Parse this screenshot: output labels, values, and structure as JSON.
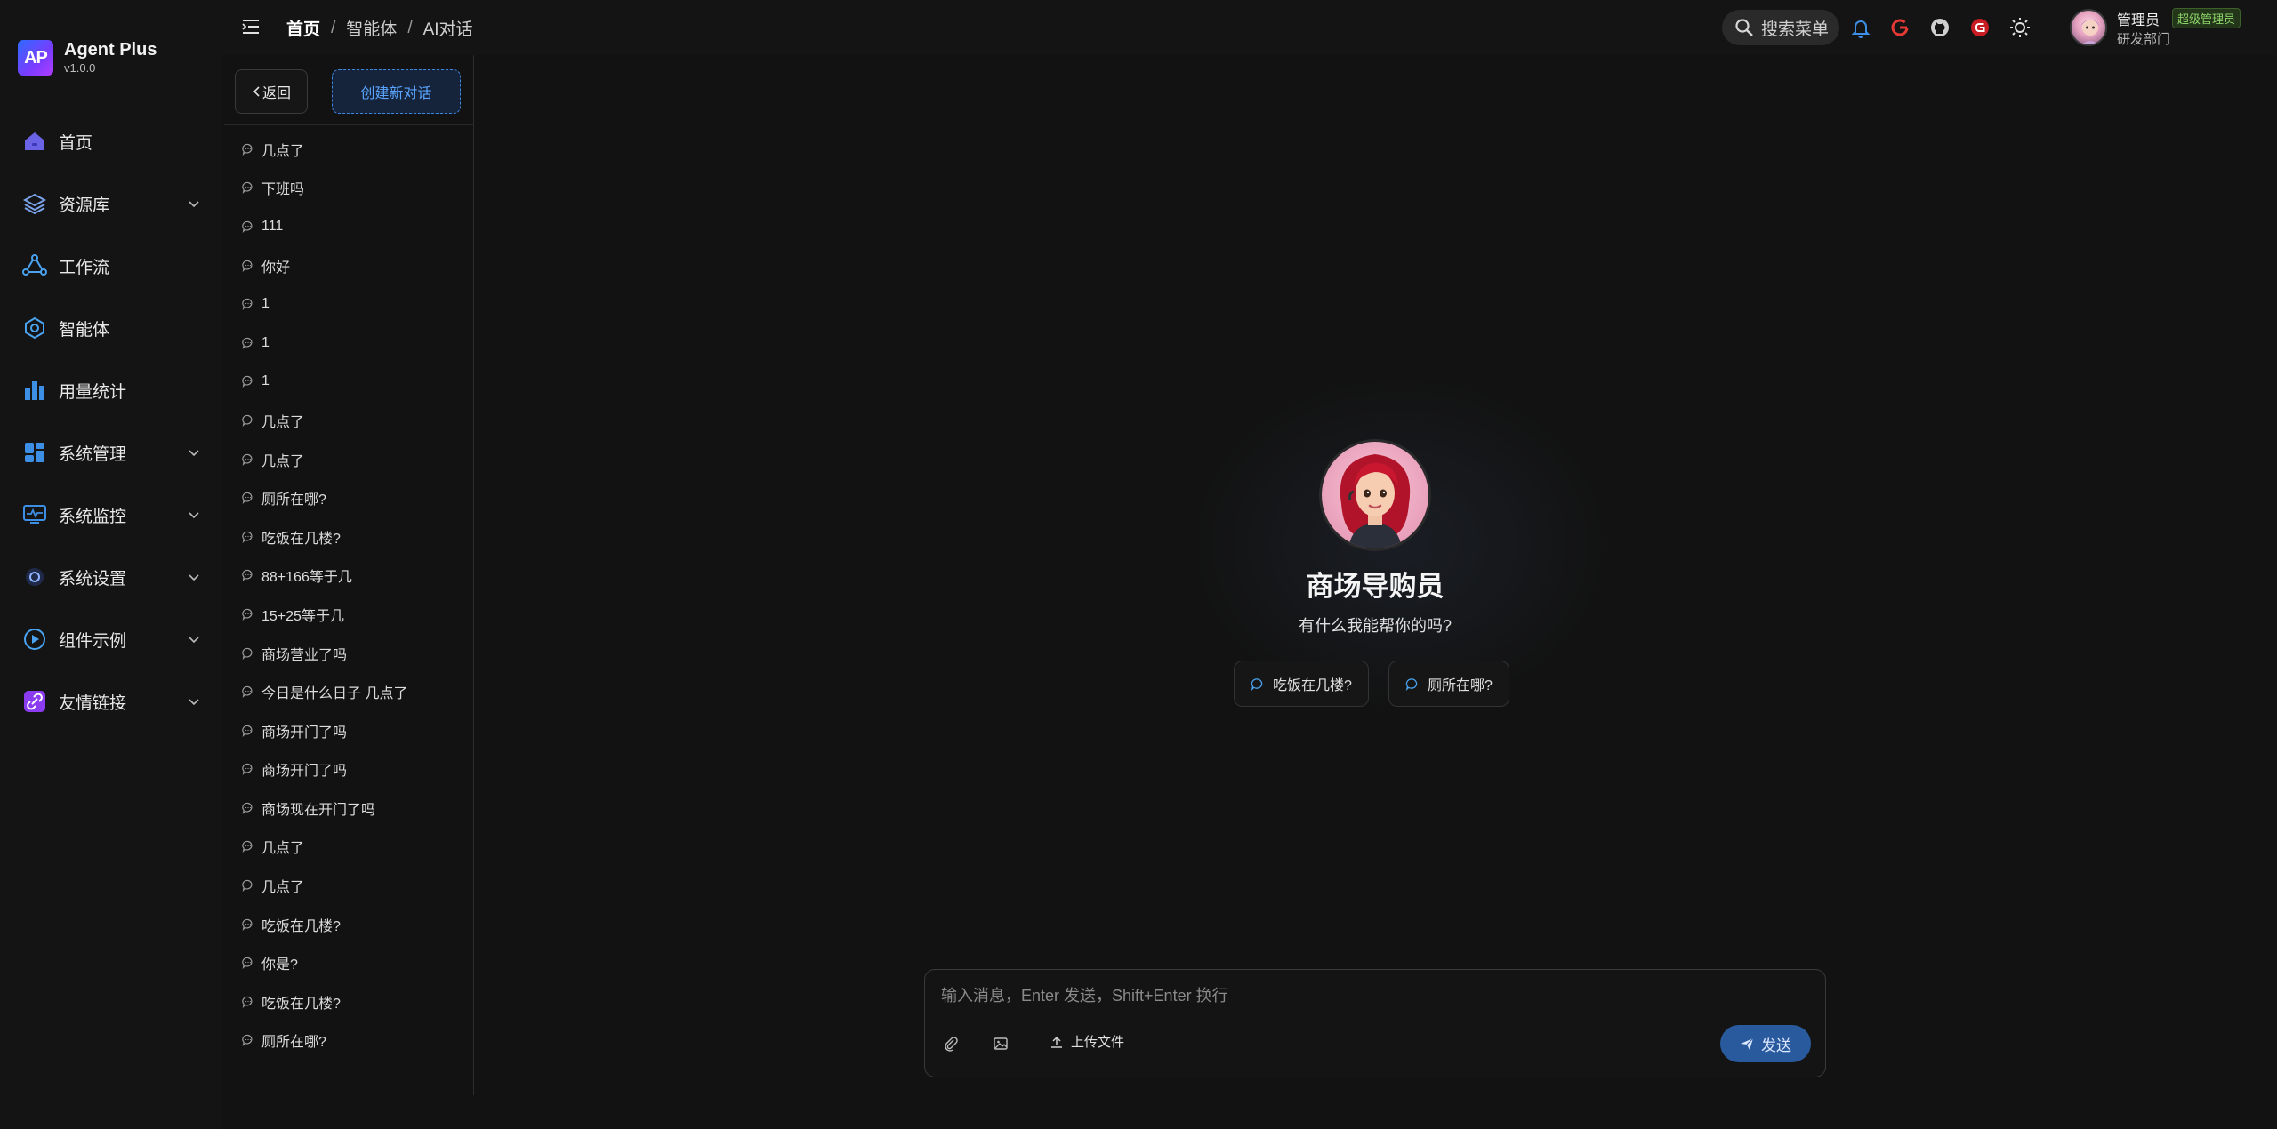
{
  "brand": {
    "name": "Agent Plus",
    "version": "v1.0.0",
    "logo_text": "AP"
  },
  "sidebar": {
    "items": [
      {
        "label": "首页",
        "icon": "home-icon",
        "expandable": false
      },
      {
        "label": "资源库",
        "icon": "layers-icon",
        "expandable": true
      },
      {
        "label": "工作流",
        "icon": "workflow-icon",
        "expandable": false
      },
      {
        "label": "智能体",
        "icon": "agent-icon",
        "expandable": false
      },
      {
        "label": "用量统计",
        "icon": "bar-chart-icon",
        "expandable": false
      },
      {
        "label": "系统管理",
        "icon": "dashboard-icon",
        "expandable": true
      },
      {
        "label": "系统监控",
        "icon": "monitor-icon",
        "expandable": true
      },
      {
        "label": "系统设置",
        "icon": "settings-icon",
        "expandable": true
      },
      {
        "label": "组件示例",
        "icon": "play-icon",
        "expandable": true
      },
      {
        "label": "友情链接",
        "icon": "link-icon",
        "expandable": true
      }
    ]
  },
  "header": {
    "breadcrumb": [
      "首页",
      "智能体",
      "AI对话"
    ],
    "search_label": "搜索菜单",
    "user": {
      "name": "管理员",
      "role": "超级管理员",
      "department": "研发部门"
    }
  },
  "conversations": {
    "back_label": "返回",
    "new_label": "创建新对话",
    "items": [
      "几点了",
      "下班吗",
      "111",
      "你好",
      "1",
      "1",
      "1",
      "几点了",
      "几点了",
      "厕所在哪?",
      "吃饭在几楼?",
      "88+166等于几",
      "15+25等于几",
      "商场营业了吗",
      "今日是什么日子 几点了",
      "商场开门了吗",
      "商场开门了吗",
      "商场现在开门了吗",
      "几点了",
      "几点了",
      "吃饭在几楼?",
      "你是?",
      "吃饭在几楼?",
      "厕所在哪?"
    ]
  },
  "agent": {
    "name": "商场导购员",
    "greeting": "有什么我能帮你的吗?",
    "suggestions": [
      "吃饭在几楼?",
      "厕所在哪?"
    ]
  },
  "composer": {
    "placeholder": "输入消息，Enter 发送，Shift+Enter 换行",
    "upload_label": "上传文件",
    "send_label": "发送"
  },
  "colors": {
    "background": "#121212",
    "accent": "#2a5a9e",
    "link_blue": "#5aa4ff",
    "role_badge": "#8ed46a"
  }
}
